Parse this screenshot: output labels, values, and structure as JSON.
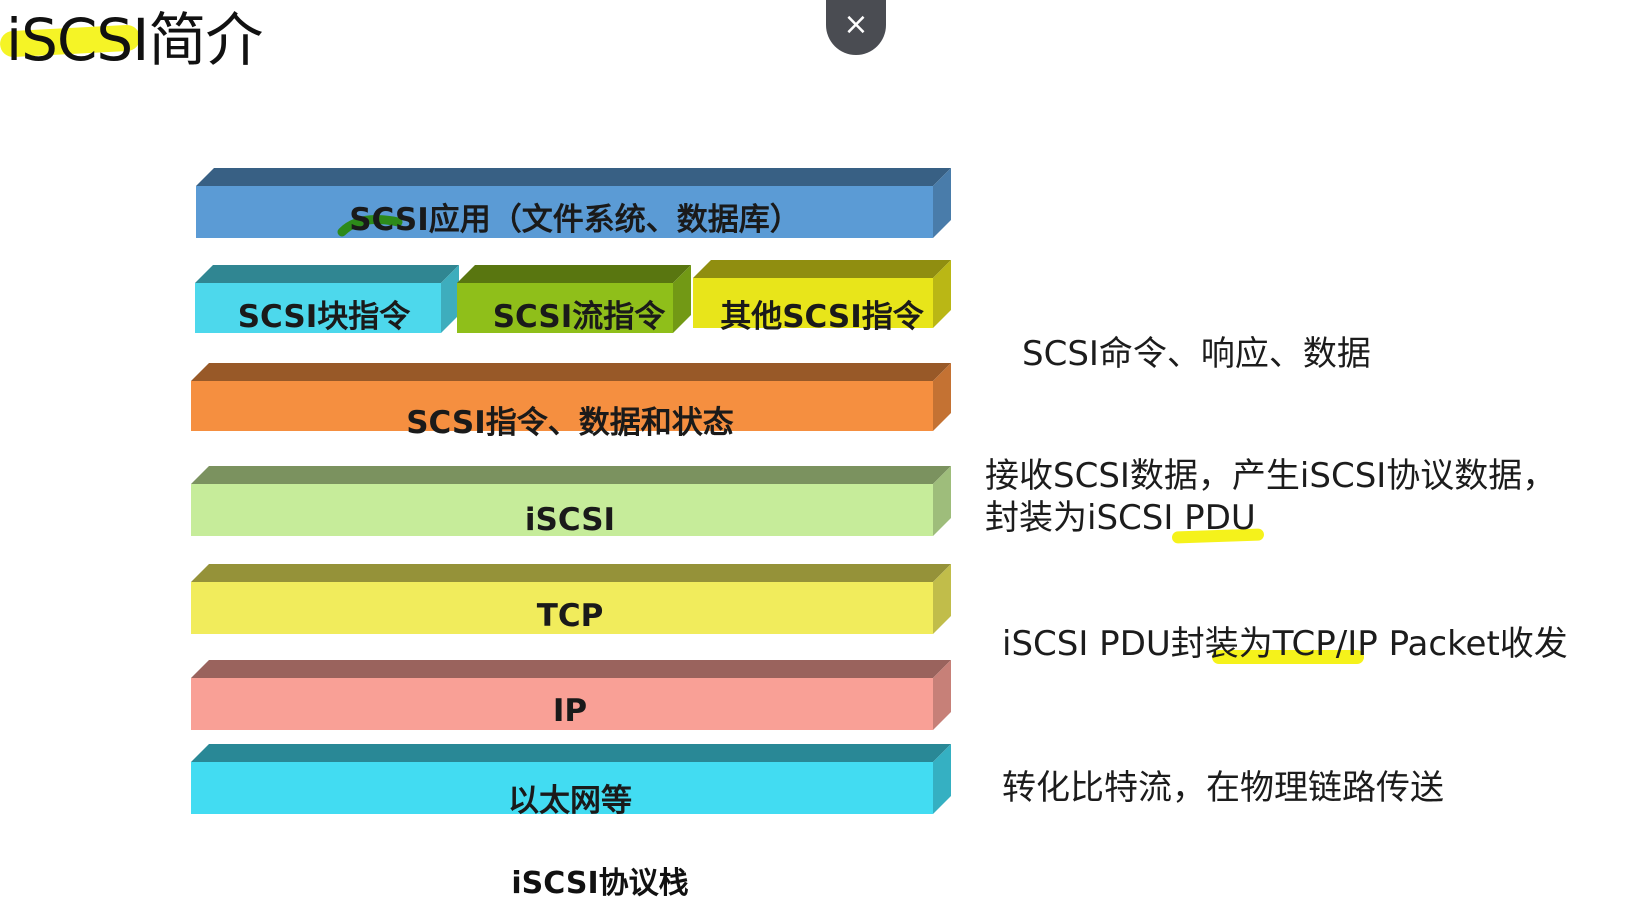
{
  "title": "iSCSI简介",
  "close_button": {
    "icon": "close-icon",
    "glyph": "×"
  },
  "layers": [
    {
      "label": "SCSI应用（文件系统、数据库）",
      "color": "#5b9bd5"
    },
    {
      "label": "SCSI块指令",
      "color": "#4dd8ec"
    },
    {
      "label": "SCSI流指令",
      "color": "#8fbf1a"
    },
    {
      "label": "其他SCSI指令",
      "color": "#e8e51a"
    },
    {
      "label": "SCSI指令、数据和状态",
      "color": "#f58f40"
    },
    {
      "label": "iSCSI",
      "color": "#c6ec9a"
    },
    {
      "label": "TCP",
      "color": "#f1ec5c"
    },
    {
      "label": "IP",
      "color": "#f9a096"
    },
    {
      "label": "以太网等",
      "color": "#42dcf2"
    }
  ],
  "descriptions": {
    "scsi": "SCSI命令、响应、数据",
    "iscsi_line1": "接收SCSI数据，产生iSCSI协议数据，",
    "iscsi_line2": "封装为iSCSI PDU",
    "tcpip": "iSCSI PDU封装为TCP/IP Packet收发",
    "ethernet": "转化比特流，在物理链路传送"
  },
  "caption": "iSCSI协议栈",
  "highlight_color": "#f5f21b"
}
